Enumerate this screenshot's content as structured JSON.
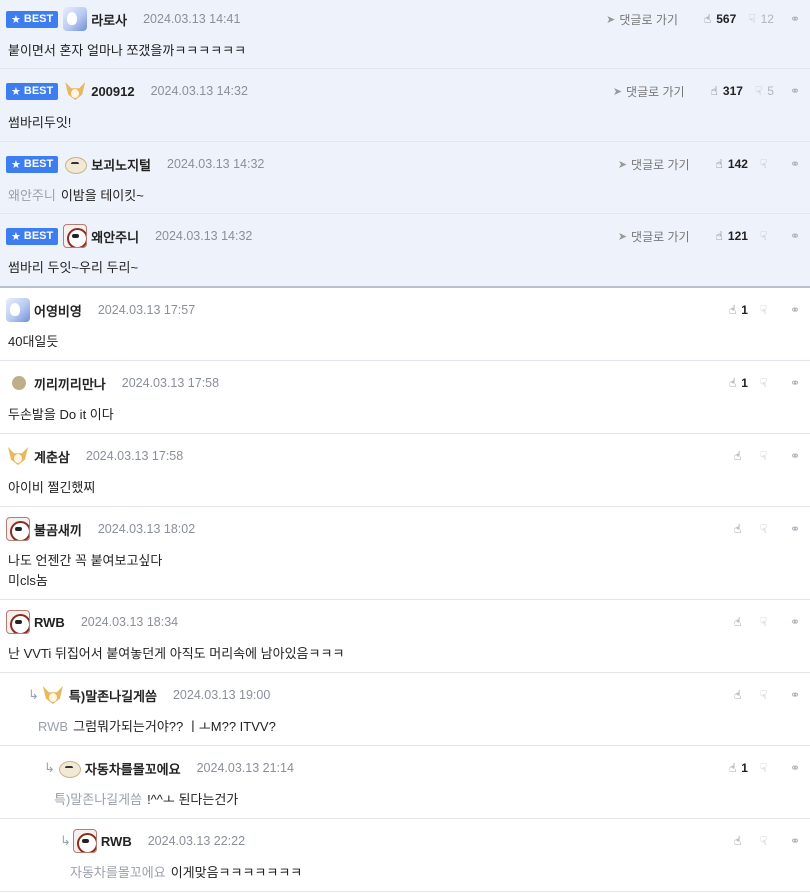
{
  "labels": {
    "best": "BEST",
    "goto": "댓글로 가기"
  },
  "icons": {
    "star": "star-icon",
    "goto": "paper-plane-icon",
    "up": "thumbs-up-icon",
    "down": "thumbs-down-icon",
    "link": "link-icon",
    "reply": "reply-arrow-icon"
  },
  "colors": {
    "best_bg": "#eef2fb",
    "badge": "#3d7df0"
  },
  "comments": [
    {
      "best": true,
      "avatar": "blue",
      "nick": "라로사",
      "date": "2024.03.13 14:41",
      "up": "567",
      "down": "12",
      "to": "",
      "text": [
        "붙이면서 혼자 얼마나 쪼갰을까ㅋㅋㅋㅋㅋㅋ"
      ],
      "depth": 0
    },
    {
      "best": true,
      "avatar": "fox",
      "nick": "200912",
      "date": "2024.03.13 14:32",
      "up": "317",
      "down": "5",
      "to": "",
      "text": [
        "썸바리두잇!"
      ],
      "depth": 0
    },
    {
      "best": true,
      "avatar": "dog",
      "nick": "보괴노지털",
      "date": "2024.03.13 14:32",
      "up": "142",
      "down": "",
      "to": "왜안주니",
      "text": [
        "이밤을 테이킷~"
      ],
      "depth": 0
    },
    {
      "best": true,
      "avatar": "red",
      "nick": "왜안주니",
      "date": "2024.03.13 14:32",
      "up": "121",
      "down": "",
      "to": "",
      "text": [
        "썸바리 두잇~우리 두리~"
      ],
      "depth": 0
    },
    {
      "best": false,
      "avatar": "blue",
      "nick": "어영비영",
      "date": "2024.03.13 17:57",
      "up": "1",
      "down": "",
      "to": "",
      "text": [
        "40대일듯"
      ],
      "depth": 0
    },
    {
      "best": false,
      "avatar": "dot",
      "nick": "끼리끼리만나",
      "date": "2024.03.13 17:58",
      "up": "1",
      "down": "",
      "to": "",
      "text": [
        "두손발을 Do it 이다"
      ],
      "depth": 0
    },
    {
      "best": false,
      "avatar": "fox",
      "nick": "계춘삼",
      "date": "2024.03.13 17:58",
      "up": "",
      "down": "",
      "to": "",
      "text": [
        "아이비 쩔긴했찌"
      ],
      "depth": 0
    },
    {
      "best": false,
      "avatar": "red",
      "nick": "불곰새끼",
      "date": "2024.03.13 18:02",
      "up": "",
      "down": "",
      "to": "",
      "text": [
        "나도 언젠간 꼭 붙여보고싶다",
        "미cls놈"
      ],
      "depth": 0
    },
    {
      "best": false,
      "avatar": "red",
      "nick": "RWB",
      "date": "2024.03.13 18:34",
      "up": "",
      "down": "",
      "to": "",
      "text": [
        "난 VVTi 뒤집어서 붙여놓던게 아직도 머리속에 남아있음ㅋㅋㅋ"
      ],
      "depth": 0
    },
    {
      "best": false,
      "avatar": "fox",
      "nick": "특)말존나길게씀",
      "date": "2024.03.13 19:00",
      "up": "",
      "down": "",
      "to": "RWB",
      "text": [
        "그럼뭐가되는거야?? ㅣㅗM?? ITVV?"
      ],
      "depth": 1
    },
    {
      "best": false,
      "avatar": "dog",
      "nick": "자동차를몰꼬에요",
      "date": "2024.03.13 21:14",
      "up": "1",
      "down": "",
      "to": "특)말존나길게씀",
      "text": [
        "!^^ㅗ 된다는건가"
      ],
      "depth": 2
    },
    {
      "best": false,
      "avatar": "red",
      "nick": "RWB",
      "date": "2024.03.13 22:22",
      "up": "",
      "down": "",
      "to": "자동차를몰꼬에요",
      "text": [
        "이게맞음ㅋㅋㅋㅋㅋㅋㅋ"
      ],
      "depth": 3
    }
  ]
}
